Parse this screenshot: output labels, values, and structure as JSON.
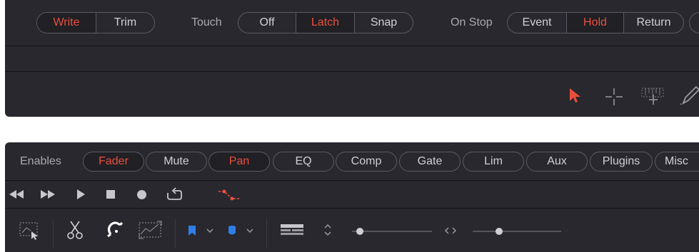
{
  "automation": {
    "write_modes": [
      "Write",
      "Trim"
    ],
    "write_active": "Write",
    "touch_label": "Touch",
    "touch_modes": [
      "Off",
      "Latch",
      "Snap"
    ],
    "touch_active": "Latch",
    "onstop_label": "On Stop",
    "onstop_modes": [
      "Event",
      "Hold",
      "Return"
    ],
    "onstop_active": "Hold"
  },
  "tools": [
    "pointer-icon",
    "crosshair-icon",
    "range-select-icon",
    "pencil-icon"
  ],
  "enables": {
    "label": "Enables",
    "items": [
      "Fader",
      "Mute",
      "Pan",
      "EQ",
      "Comp",
      "Gate",
      "Lim",
      "Aux",
      "Plugins",
      "Misc"
    ],
    "active": [
      "Fader",
      "Pan"
    ]
  },
  "transport": [
    "rewind-icon",
    "fast-forward-icon",
    "play-icon",
    "stop-icon",
    "record-icon",
    "loop-icon",
    "automation-curve-icon"
  ],
  "edit_tools": [
    "selection-tool-icon",
    "razor-icon",
    "snap-magnet-icon",
    "zoom-region-icon",
    "blue-marker-icon",
    "flag-marker-icon",
    "track-height-icon",
    "vertical-zoom-icon",
    "horizontal-zoom-icon"
  ],
  "sliders": {
    "vertical_zoom": 0.1,
    "horizontal_zoom": 0.3
  },
  "colors": {
    "accent": "#ec4e3d",
    "marker_blue": "#2f7ee6",
    "panel": "#28282e"
  }
}
